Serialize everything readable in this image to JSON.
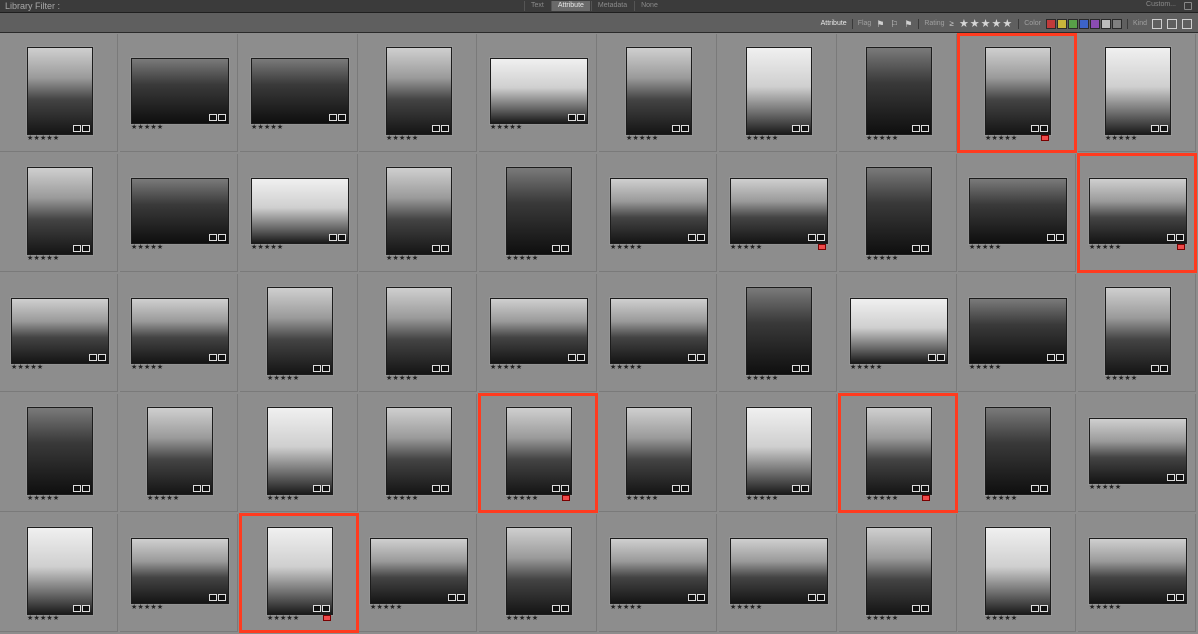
{
  "topbar": {
    "title": "Library Filter :",
    "tabs": [
      {
        "label": "Text"
      },
      {
        "label": "Attribute",
        "active": true
      },
      {
        "label": "Metadata"
      },
      {
        "label": "None"
      }
    ],
    "custom_label": "Custom..."
  },
  "attribute_bar": {
    "attribute_label": "Attribute",
    "flag_label": "Flag",
    "rating_label": "Rating",
    "rating_operator": "≥",
    "rating_stars": "★★★★★",
    "color_label": "Color",
    "kind_label": "Kind",
    "color_swatches": [
      "#c03a3a",
      "#c9b63b",
      "#58a048",
      "#3d63c7",
      "#8b4cb2",
      "#bdbdbd",
      "#7f7f7f"
    ]
  },
  "grid": {
    "rating_text": "★★★★★",
    "selection_color": "#ff3b1f",
    "cells": [
      {
        "orient": "p",
        "tone": "mid"
      },
      {
        "orient": "l",
        "tone": "dark"
      },
      {
        "orient": "l",
        "tone": "dark"
      },
      {
        "orient": "p",
        "tone": "mid"
      },
      {
        "orient": "l",
        "tone": "light"
      },
      {
        "orient": "p",
        "tone": "mid"
      },
      {
        "orient": "p",
        "tone": "light"
      },
      {
        "orient": "p",
        "tone": "dark"
      },
      {
        "orient": "p",
        "tone": "mid",
        "selected": true,
        "red_label": true
      },
      {
        "orient": "p",
        "tone": "light"
      },
      {
        "orient": "p",
        "tone": "mid"
      },
      {
        "orient": "l",
        "tone": "dark"
      },
      {
        "orient": "l",
        "tone": "light"
      },
      {
        "orient": "p",
        "tone": "mid"
      },
      {
        "orient": "p",
        "tone": "dark"
      },
      {
        "orient": "l",
        "tone": "mid"
      },
      {
        "orient": "l",
        "tone": "mid",
        "red_label": true
      },
      {
        "orient": "p",
        "tone": "dark"
      },
      {
        "orient": "l",
        "tone": "dark"
      },
      {
        "orient": "l",
        "tone": "mid",
        "selected": true,
        "red_label": true
      },
      {
        "orient": "l",
        "tone": "mid"
      },
      {
        "orient": "l",
        "tone": "mid"
      },
      {
        "orient": "p",
        "tone": "mid"
      },
      {
        "orient": "p",
        "tone": "mid"
      },
      {
        "orient": "l",
        "tone": "mid"
      },
      {
        "orient": "l",
        "tone": "mid"
      },
      {
        "orient": "p",
        "tone": "dark"
      },
      {
        "orient": "l",
        "tone": "light"
      },
      {
        "orient": "l",
        "tone": "dark"
      },
      {
        "orient": "p",
        "tone": "mid"
      },
      {
        "orient": "p",
        "tone": "dark"
      },
      {
        "orient": "p",
        "tone": "mid"
      },
      {
        "orient": "p",
        "tone": "light"
      },
      {
        "orient": "p",
        "tone": "mid"
      },
      {
        "orient": "p",
        "tone": "mid",
        "selected": true,
        "red_label": true
      },
      {
        "orient": "p",
        "tone": "mid"
      },
      {
        "orient": "p",
        "tone": "light"
      },
      {
        "orient": "p",
        "tone": "mid",
        "selected": true,
        "red_label": true
      },
      {
        "orient": "p",
        "tone": "dark"
      },
      {
        "orient": "l",
        "tone": "mid"
      },
      {
        "orient": "p",
        "tone": "light"
      },
      {
        "orient": "l",
        "tone": "mid"
      },
      {
        "orient": "p",
        "tone": "light",
        "selected": true,
        "red_label": true
      },
      {
        "orient": "l",
        "tone": "mid"
      },
      {
        "orient": "p",
        "tone": "mid"
      },
      {
        "orient": "l",
        "tone": "mid"
      },
      {
        "orient": "l",
        "tone": "mid"
      },
      {
        "orient": "p",
        "tone": "mid"
      },
      {
        "orient": "p",
        "tone": "light"
      },
      {
        "orient": "l",
        "tone": "mid"
      }
    ]
  }
}
